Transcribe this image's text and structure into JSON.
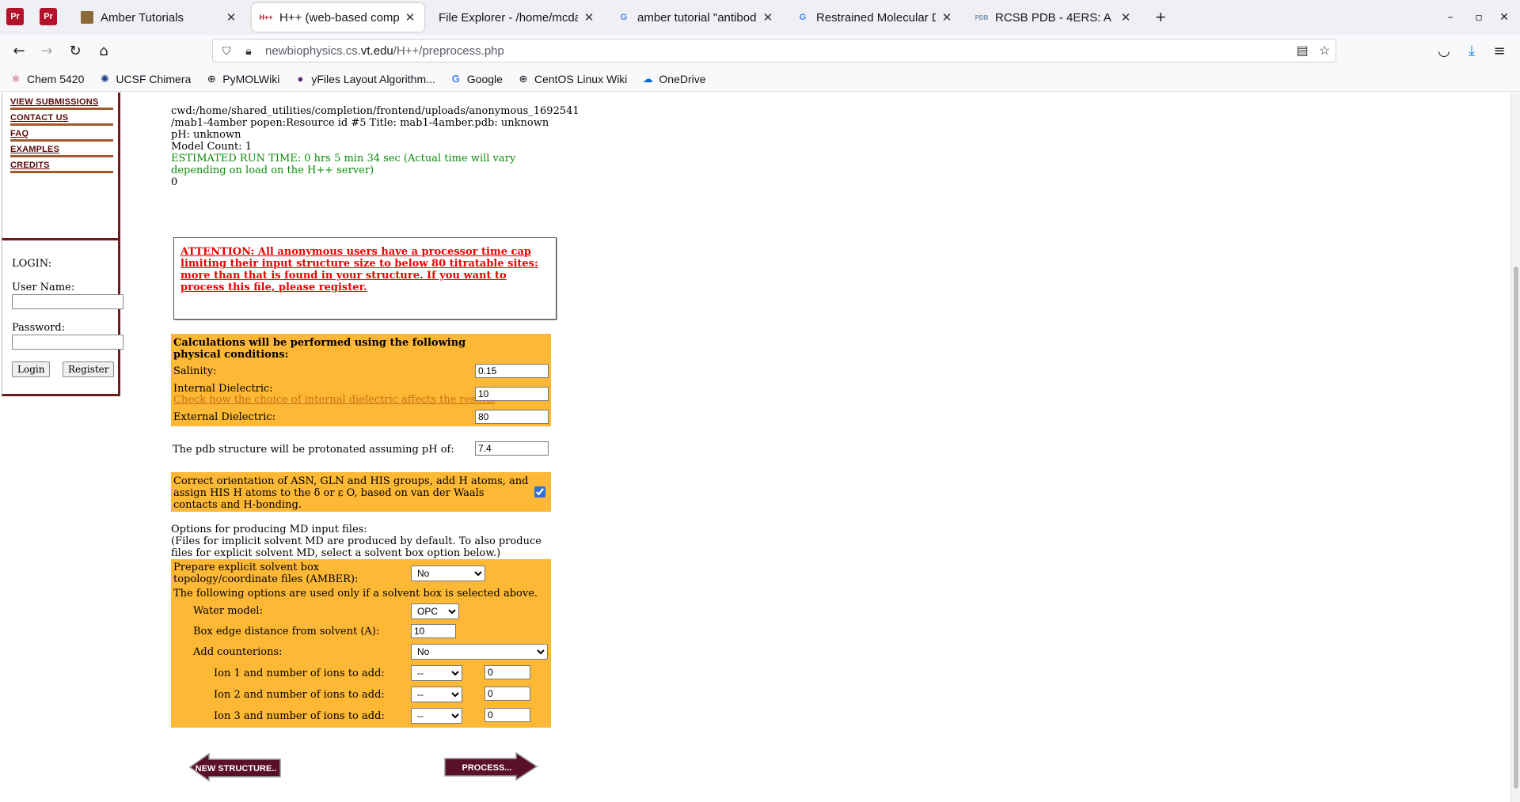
{
  "browser": {
    "pinned": [
      {
        "label": "Pr"
      },
      {
        "label": "Pr"
      }
    ],
    "tabs": [
      {
        "title": "Amber Tutorials",
        "icon": "amber-icon"
      },
      {
        "title": "H++ (web-based computational...",
        "icon": "hpp-icon"
      },
      {
        "title": "File Explorer - /home/mcdan...",
        "icon": "file-icon"
      },
      {
        "title": "amber tutorial \"antibody\" s...",
        "icon": "google-icon"
      },
      {
        "title": "Restrained Molecular Dyn...",
        "icon": "google-icon"
      },
      {
        "title": "RCSB PDB - 4ERS: A Mole...",
        "icon": "pdb-icon"
      }
    ],
    "url_host_prefix": "newbiophysics.cs.",
    "url_host_main": "vt.edu",
    "url_path": "/H++/preprocess.php",
    "bookmarks": [
      {
        "label": "Chem 5420"
      },
      {
        "label": "UCSF Chimera"
      },
      {
        "label": "PyMOLWiki"
      },
      {
        "label": "yFiles Layout Algorithm..."
      },
      {
        "label": "Google"
      },
      {
        "label": "CentOS Linux Wiki"
      },
      {
        "label": "OneDrive"
      }
    ]
  },
  "sidebar": {
    "menu": [
      "VIEW SUBMISSIONS",
      "CONTACT US",
      "FAQ",
      "EXAMPLES",
      "CREDITS"
    ],
    "login": {
      "title": "LOGIN:",
      "username_label": "User Name:",
      "password_label": "Password:",
      "login_button": "Login",
      "register_button": "Register"
    }
  },
  "info": {
    "cwd_line1": "cwd:/home/shared_utilities/completion/frontend/uploads/anonymous_1692541",
    "cwd_line2": "/mab1-4amber popen:Resource id #5 Title: mab1-4amber.pdb: unknown",
    "ph": "pH: unknown",
    "model_count": "Model Count: 1",
    "runtime": "ESTIMATED RUN TIME: 0 hrs 5 min 34 sec (Actual time will vary depending on load on the H++ server)",
    "zero": "0"
  },
  "attention": "ATTENTION: All anonymous users have a processor time cap limiting their input structure size to below 80 titratable sites: more than that is found in your structure. If you want to process this file, please register.",
  "physical": {
    "heading": "Calculations will be performed using the following physical conditions:",
    "salinity_label": "Salinity:",
    "salinity_value": "0.15",
    "internal_label": "Internal Dielectric:",
    "internal_link": "Check how the choice of internal dielectric affects the results",
    "internal_value": "10",
    "external_label": "External Dielectric:",
    "external_value": "80"
  },
  "ph": {
    "label": "The pdb structure will be protonated assuming pH of:",
    "value": "7.4"
  },
  "orientation": {
    "text": "Correct orientation of ASN, GLN and HIS groups, add H atoms, and assign HIS H atoms to the δ or ε O, based on van der Waals contacts and H-bonding.",
    "checked": true
  },
  "md": {
    "intro1": "Options for producing MD input files:",
    "intro2": "(Files for implicit solvent MD are produced by default. To also produce files for explicit solvent MD, select a solvent box option below.)",
    "explicit_label": "Prepare explicit solvent box topology/coordinate files (AMBER):",
    "explicit_value": "No",
    "note": "The following options are used only if a solvent box is selected above.",
    "water_label": "Water model:",
    "water_value": "OPC",
    "box_label": "Box edge distance from solvent (A):",
    "box_value": "10",
    "counterions_label": "Add counterions:",
    "counterions_value": "No",
    "ions": [
      {
        "label": "Ion 1 and number of ions to add:",
        "ion": "--",
        "count": "0"
      },
      {
        "label": "Ion 2 and number of ions to add:",
        "ion": "--",
        "count": "0"
      },
      {
        "label": "Ion 3 and number of ions to add:",
        "ion": "--",
        "count": "0"
      }
    ]
  },
  "buttons": {
    "new_structure": "NEW STRUCTURE..",
    "process": "PROCESS..."
  },
  "colors": {
    "orange_panel": "#fdb835",
    "attention_red": "#ee0000",
    "runtime_green": "#0a8a0a",
    "sidebar_maroon": "#6e1b1b"
  }
}
